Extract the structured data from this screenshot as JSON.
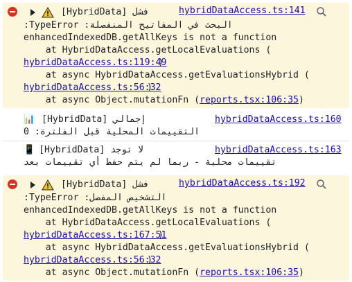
{
  "messages": [
    {
      "level": "error",
      "label": "فشل [HybridData]",
      "source": "hybridDataAccess.ts:141",
      "lines": [
        "البحث في المفاتيح المنفصلة: TypeError:",
        "enhancedIndexedDB.getAllKeys is not a function",
        "    at HybridDataAccess.getLocalEvaluations (",
        "hybridDataAccess.ts:119:49)",
        "    at async HybridDataAccess.getEvaluationsHybrid (",
        "hybridDataAccess.ts:56:32)",
        "    at async Object.mutationFn (reports.tsx:106:35)"
      ],
      "links": [
        "hybridDataAccess.ts:119:49",
        "hybridDataAccess.ts:56:32",
        "reports.tsx:106:35"
      ]
    },
    {
      "level": "info",
      "emoji": "📊",
      "label": "[HybridData] إجمالي",
      "text2": "التقييمات المحلية قبل الفلترة: 0",
      "source": "hybridDataAccess.ts:160"
    },
    {
      "level": "info",
      "emoji": "📱",
      "label": "[HybridData] لا توجد",
      "text2": "تقييمات محلية - ربما لم يتم حفظ أي تقييمات بعد",
      "source": "hybridDataAccess.ts:163"
    },
    {
      "level": "error",
      "label": "فشل [HybridData]",
      "source": "hybridDataAccess.ts:192",
      "lines": [
        "التشخيص المفصل: TypeError:",
        "enhancedIndexedDB.getAllKeys is not a function",
        "    at HybridDataAccess.getLocalEvaluations (",
        "hybridDataAccess.ts:167:51)",
        "    at async HybridDataAccess.getEvaluationsHybrid (",
        "hybridDataAccess.ts:56:32)",
        "    at async Object.mutationFn (reports.tsx:106:35)"
      ],
      "links": [
        "hybridDataAccess.ts:167:51",
        "hybridDataAccess.ts:56:32",
        "reports.tsx:106:35"
      ]
    }
  ]
}
